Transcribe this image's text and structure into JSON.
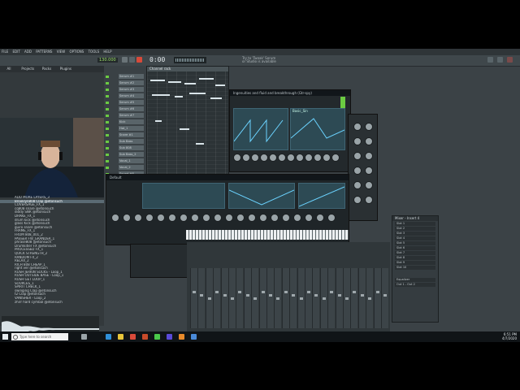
{
  "menu": [
    "FILE",
    "EDIT",
    "ADD",
    "PATTERNS",
    "VIEW",
    "OPTIONS",
    "TOOLS",
    "HELP"
  ],
  "transport": {
    "time": "0:00",
    "tempo": "130.000",
    "pattern": "Pattern 1"
  },
  "hint": [
    "Try to 'Tweak' Serum",
    "or Studio is available"
  ],
  "browser": {
    "tabs": [
      "All",
      "Projects",
      "Packs",
      "Plugins"
    ],
    "files": [
      "ADD MORE LAYERS_3",
      "Brooklyn808 Clap @etonsuch",
      "COVERSAGE_FX_1",
      "cq808 snare @etonsuch",
      "diddy SNR @etonsuch",
      "DRAKE_FX_1",
      "drum kick @etonsuch",
      "glass Kick @etonsuch",
      "guiro snare @etonsuch",
      "FRAME_FX_1",
      "FROM 808_001_2",
      "PASSER FW_GRANDER_1",
      "phrase808 @etonsuch",
      "Drumkitler FX @etonsuch",
      "PROCESSED FX_1",
      "QUICK STRENGTH_2",
      "RANDOM FX_2",
      "RELAX_2",
      "RICH 808 CHEAP_1",
      "right ver @etonsuch",
      "RUSH JERKIN SOCKS - Loop_1",
      "RUSH OUTSIDE BASE - Loop_1",
      "RUSH GET LOOP_1",
      "SOURCES_1",
      "SPIRIT CHECK_1",
      "swinging Clap @etonsuch",
      "t2 Clap @etonsuch",
      "VANISHER - Loop_2",
      "zhirr hard cymbal @etonsuch"
    ],
    "selected_index": 1
  },
  "channel_rack": {
    "title": "Channel rack",
    "channels": [
      "Serum #1",
      "Serum #2",
      "Serum #3",
      "Serum #4",
      "Serum #5",
      "Serum #6",
      "Serum #7",
      "Kick",
      "Hat_1",
      "Snare #1",
      "Sub Bass",
      "Sub 808",
      "Sub Bass_2",
      "Vocal_1",
      "Vocal_2",
      "Sound #8",
      "Sound #9",
      "Perc #10"
    ]
  },
  "piano_roll": {
    "title": "Piano roll - Serum"
  },
  "serum_small": {
    "preset": "Ingenuities and fluid and breakthrough (Gtr-spy)",
    "panel": "Basic_Sin"
  },
  "serum_big": {
    "preset": "Default"
  },
  "mixer_send": {
    "title": "Mixer - Insert 4",
    "slots": [
      "Slot 1",
      "Slot 2",
      "Slot 3",
      "Slot 4",
      "Slot 5",
      "Slot 6",
      "Slot 7",
      "Slot 8",
      "Slot 9",
      "Slot 10"
    ],
    "footer": [
      "Equalizer",
      "Out 1 - Out 2"
    ]
  },
  "taskbar": {
    "search": "Type here to search",
    "time": "6:51 PM",
    "date": "4/7/2020"
  },
  "colors": {
    "accent_green": "#6bcb42",
    "serum_teal": "#2d4a54",
    "fl_panel": "#3b4246"
  }
}
